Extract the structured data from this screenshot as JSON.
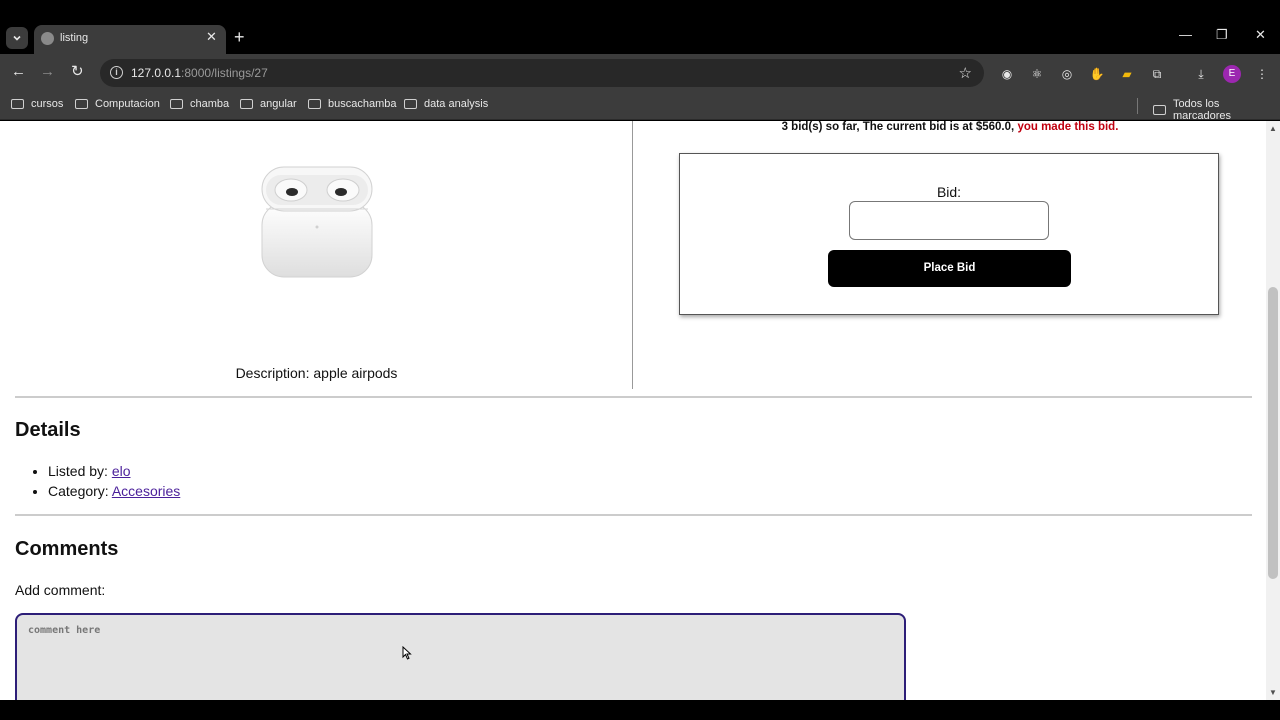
{
  "browser": {
    "tab_title": "listing",
    "url_host": "127.0.0.1",
    "url_rest": ":8000/listings/27",
    "bookmarks": [
      "cursos",
      "Computacion",
      "chamba",
      "angular",
      "buscachamba",
      "data analysis"
    ],
    "all_bookmarks_label": "Todos los marcadores",
    "profile_initial": "E"
  },
  "listing": {
    "description": "Description: apple airpods",
    "bid_status_main": "3 bid(s) so far, The current bid is at $560.0,",
    "bid_status_mine": "you made this bid.",
    "bid_label": "Bid:",
    "bid_value": "",
    "place_bid_label": "Place Bid"
  },
  "details": {
    "heading": "Details",
    "listed_by_label": "Listed by:",
    "listed_by_value": "elo",
    "category_label": "Category:",
    "category_value": "Accesories"
  },
  "comments": {
    "heading": "Comments",
    "add_label": "Add comment:",
    "placeholder": "comment here"
  }
}
